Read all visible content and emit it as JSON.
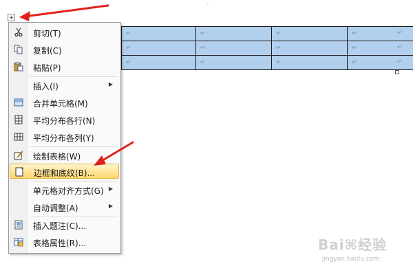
{
  "document": {
    "top_mark": "·",
    "move_handle": "+",
    "table": {
      "rows": [
        [
          "",
          "↵",
          "↵",
          "↵",
          "↵"
        ],
        [
          "",
          "↵",
          "↵",
          "↵",
          "↵"
        ],
        [
          "",
          "↵",
          "↵",
          "↵",
          "↵"
        ]
      ],
      "row_end_marks": [
        "↵",
        "↵",
        "↵"
      ]
    },
    "cell_fill_color": "#b3cfee"
  },
  "context_menu": {
    "items": [
      {
        "label": "剪切(T)",
        "icon": "scissors-icon",
        "submenu": false
      },
      {
        "label": "复制(C)",
        "icon": "copy-icon",
        "submenu": false
      },
      {
        "label": "粘贴(P)",
        "icon": "paste-icon",
        "submenu": false
      },
      {
        "label": "插入(I)",
        "icon": "",
        "submenu": true
      },
      {
        "label": "合并单元格(M)",
        "icon": "merge-cells-icon",
        "submenu": false
      },
      {
        "label": "平均分布各行(N)",
        "icon": "distribute-rows-icon",
        "submenu": false
      },
      {
        "label": "平均分布各列(Y)",
        "icon": "distribute-columns-icon",
        "submenu": false
      },
      {
        "label": "绘制表格(W)",
        "icon": "draw-table-icon",
        "submenu": false
      },
      {
        "label": "边框和底纹(B)...",
        "icon": "borders-shading-icon",
        "submenu": false,
        "highlighted": true
      },
      {
        "label": "单元格对齐方式(G)",
        "icon": "",
        "submenu": true
      },
      {
        "label": "自动调整(A)",
        "icon": "",
        "submenu": true
      },
      {
        "label": "插入题注(C)...",
        "icon": "insert-caption-icon",
        "submenu": false
      },
      {
        "label": "表格属性(R)...",
        "icon": "table-properties-icon",
        "submenu": false
      }
    ],
    "highlight_color": "#ffd76e"
  },
  "annotation_arrows": {
    "color": "#e0211c",
    "count": 2
  },
  "watermark": {
    "main": "Bai⌘经验",
    "sub": "jingyan.baidu.com"
  }
}
